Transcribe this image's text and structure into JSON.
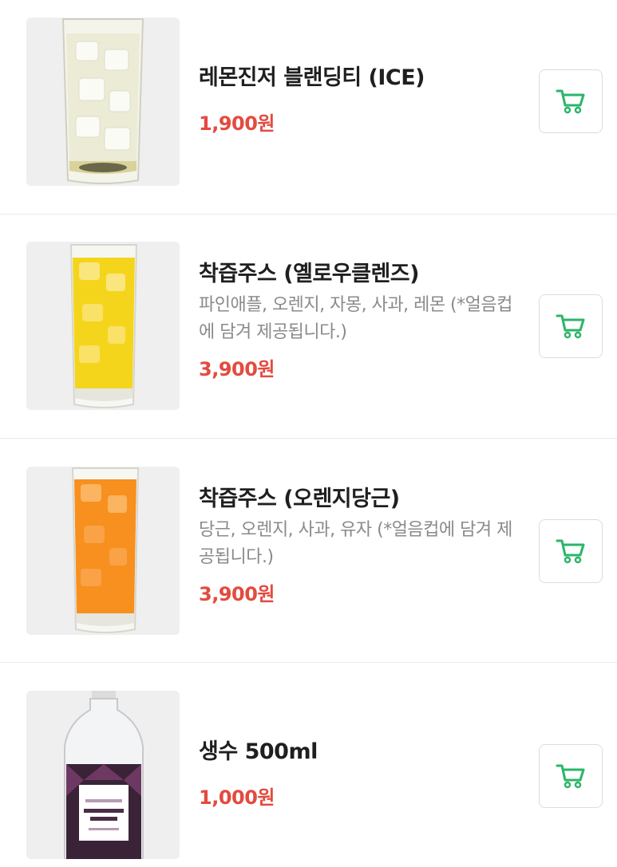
{
  "items": [
    {
      "name": "레몬진저 블랜딩티 (ICE)",
      "description": "",
      "price": "1,900원",
      "image": "iced-lemon-ginger-tea-glass"
    },
    {
      "name": "착즙주스 (옐로우클렌즈)",
      "description": "파인애플, 오렌지, 자몽, 사과, 레몬 (*얼음컵에 담겨 제공됩니다.)",
      "price": "3,900원",
      "image": "yellow-juice-glass"
    },
    {
      "name": "착즙주스 (오렌지당근)",
      "description": "당근, 오렌지, 사과, 유자 (*얼음컵에 담겨 제공됩니다.)",
      "price": "3,900원",
      "image": "orange-carrot-juice-glass"
    },
    {
      "name": "생수 500ml",
      "description": "",
      "price": "1,000원",
      "image": "water-bottle"
    }
  ],
  "icons": {
    "cart": "cart-icon"
  },
  "colors": {
    "price": "#e34b3f",
    "cart_icon": "#2bb56a",
    "divider": "#e9e9e9",
    "description": "#8a8a8a"
  }
}
